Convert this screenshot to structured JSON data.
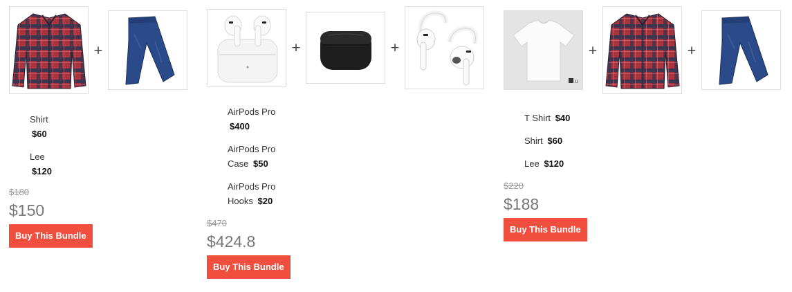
{
  "plus_sign": "+",
  "bundles": [
    {
      "items": [
        {
          "name": "Shirt",
          "price": "$60"
        },
        {
          "name": "Lee",
          "price": "$120"
        }
      ],
      "old_price": "$180",
      "new_price": "$150",
      "button_label": "Buy This Bundle",
      "images": [
        "plaid-shirt-image",
        "jeans-image"
      ]
    },
    {
      "items": [
        {
          "name": "AirPods Pro",
          "price": "$400"
        },
        {
          "name": "AirPods Pro Case",
          "price": "$50"
        },
        {
          "name": "AirPods Pro Hooks",
          "price": "$20"
        }
      ],
      "old_price": "$470",
      "new_price": "$424.8",
      "button_label": "Buy This Bundle",
      "images": [
        "airpods-pro-image",
        "airpods-case-image",
        "airpods-hooks-image"
      ]
    },
    {
      "items": [
        {
          "name": "T Shirt",
          "price": "$40"
        },
        {
          "name": "Shirt",
          "price": "$60"
        },
        {
          "name": "Lee",
          "price": "$120"
        }
      ],
      "old_price": "$220",
      "new_price": "$188",
      "button_label": "Buy This Bundle",
      "images": [
        "white-tshirt-image",
        "plaid-shirt-image",
        "jeans-image"
      ],
      "tshirt_tag": "U"
    }
  ],
  "colors": {
    "button_bg": "#f04e3e",
    "button_text": "#ffffff",
    "old_price": "#999999",
    "new_price": "#777777"
  }
}
